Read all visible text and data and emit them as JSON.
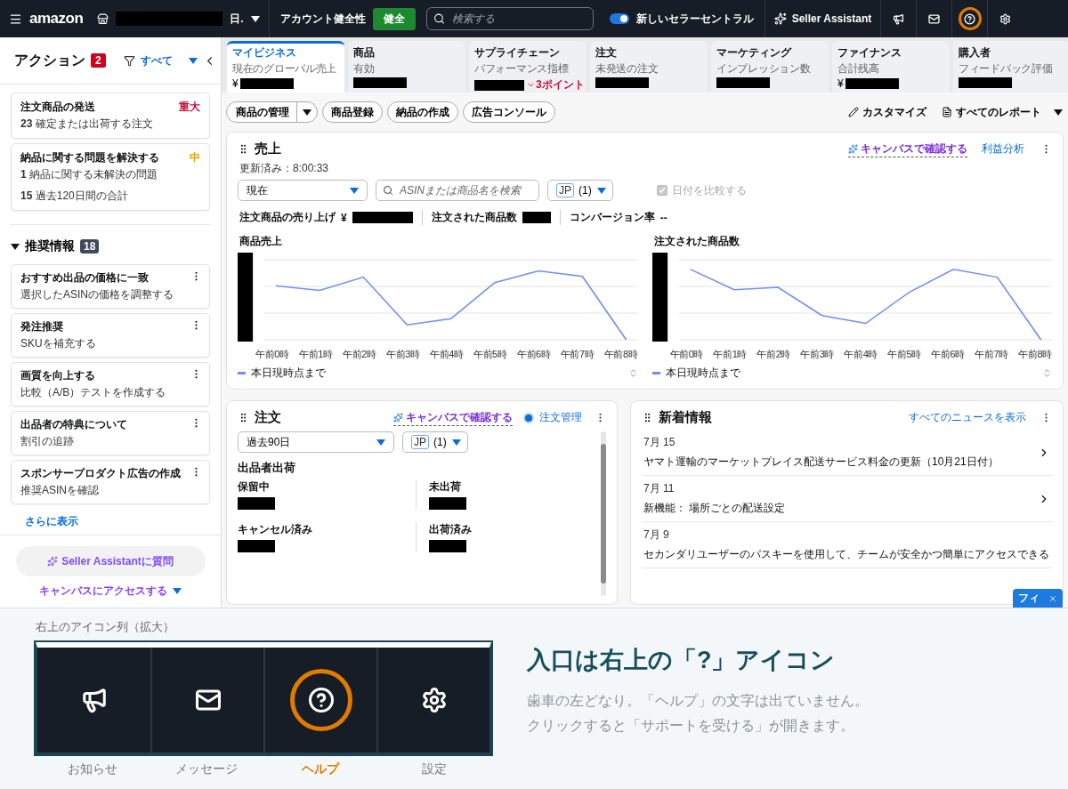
{
  "topbar": {
    "logo": "amazon",
    "store_menu": "日.",
    "health_label": "アカウント健全性",
    "health_status": "健全",
    "search_placeholder": "検索する",
    "new_ui": {
      "label": "新しいセラーセントラル",
      "on": true
    },
    "assistant": "Seller Assistant",
    "icons": [
      {
        "kind": "megaphone",
        "highlighted": false
      },
      {
        "kind": "mail",
        "highlighted": false
      },
      {
        "kind": "help",
        "highlighted": true
      },
      {
        "kind": "gear",
        "highlighted": false
      }
    ]
  },
  "sidebar": {
    "title": "アクション",
    "count": "2",
    "filter": "すべて",
    "actions": [
      {
        "title": "注文商品の発送",
        "priority": "重大",
        "color": "#cc0c39",
        "lines": [
          {
            "count": "23",
            "text": "確定または出荷する注文"
          }
        ]
      },
      {
        "title": "納品に関する問題を解決する",
        "priority": "中",
        "color": "#e3a008",
        "lines": [
          {
            "count": "1",
            "text": "納品に関する未解決の問題"
          },
          {
            "count": "15",
            "text": "過去120日間の合計"
          }
        ]
      }
    ],
    "recommendations": {
      "title": "推奨情報",
      "count": "18",
      "expanded": true,
      "items": [
        {
          "title": "おすすめ出品の価格に一致",
          "text": "選択したASINの価格を調整する"
        },
        {
          "title": "発注推奨",
          "text": "SKUを補充する"
        },
        {
          "title": "画質を向上する",
          "text": "比較（A/B）テストを作成する"
        },
        {
          "title": "出品者の特典について",
          "text": "割引の追跡"
        },
        {
          "title": "スポンサープロダクト広告の作成",
          "text": "推奨ASINを確認"
        }
      ]
    },
    "more": "さらに表示",
    "assistant_button": "Seller Assistantに質問",
    "canvas_link": "キャンバスにアクセスする"
  },
  "tabs": [
    {
      "title": "マイビジネス",
      "subtitle": "現在のグローバル売上",
      "currency": "¥",
      "selected": true
    },
    {
      "title": "商品",
      "subtitle": "有効",
      "selected": false
    },
    {
      "title": "サプライチェーン",
      "subtitle": "パフォーマンス指標",
      "delta": "3ポイント",
      "selected": false
    },
    {
      "title": "注文",
      "subtitle": "未発送の注文",
      "selected": false
    },
    {
      "title": "マーケティング",
      "subtitle": "インプレッション数",
      "selected": false
    },
    {
      "title": "ファイナンス",
      "subtitle": "合計残高",
      "currency": "¥",
      "selected": false
    },
    {
      "title": "購入者",
      "subtitle": "フィードバック評価",
      "selected": false
    }
  ],
  "quick_actions": [
    {
      "label": "商品の管理",
      "kind": "split"
    },
    {
      "label": "商品登録",
      "kind": "plain"
    },
    {
      "label": "納品の作成",
      "kind": "plain"
    },
    {
      "label": "広告コンソール",
      "kind": "plain"
    }
  ],
  "tools": {
    "customize": "カスタマイズ",
    "reports": "すべてのレポート"
  },
  "sales": {
    "title": "売上",
    "canvas_link": "キャンバスで確認する",
    "link": "利益分析",
    "updated": "更新済み：8:00:33",
    "period": "現在",
    "search_placeholder": "ASINまたは商品名を検索",
    "marketplace": "JP",
    "marketplace_count": "(1)",
    "compare": {
      "label": "日付を比較する",
      "checked": true,
      "disabled": true
    },
    "metrics": [
      {
        "label": "注文商品の売り上げ",
        "prefix": "¥"
      },
      {
        "label": "注文された商品数"
      },
      {
        "label": "コンバージョン率",
        "value": "--"
      }
    ],
    "charts": [
      {
        "title": "商品売上",
        "x_labels": [
          "午前0時",
          "午前1時",
          "午前2時",
          "午前3時",
          "午前4時",
          "午前5時",
          "午前6時",
          "午前7時",
          "午前8時"
        ],
        "legend": "本日現時点まで"
      },
      {
        "title": "注文された商品数",
        "x_labels": [
          "午前0時",
          "午前1時",
          "午前2時",
          "午前3時",
          "午前4時",
          "午前5時",
          "午前6時",
          "午前7時",
          "午前8時"
        ],
        "legend": "本日現時点まで"
      }
    ]
  },
  "orders": {
    "title": "注文",
    "canvas_link": "キャンバスで確認する",
    "toggle": {
      "label": "注文管理",
      "on": true
    },
    "period": "過去90日",
    "marketplace": "JP",
    "marketplace_count": "(1)",
    "section": "出品者出荷",
    "stats": [
      "保留中",
      "未出荷",
      "キャンセル済み",
      "出荷済み"
    ]
  },
  "news": {
    "title": "新着情報",
    "link": "すべてのニュースを表示",
    "items": [
      {
        "date": "7月 15",
        "title": "ヤマト運輸のマーケットプレイス配送サービス料金の更新（10月21日付）"
      },
      {
        "date": "7月 11",
        "title": "新機能： 場所ごとの配送設定"
      },
      {
        "date": "7月 9",
        "title": "セカンダリユーザーのパスキーを使用して、チームが安全かつ簡単にアクセスできる"
      }
    ],
    "feedback": "フィ"
  },
  "annotation": {
    "caption": "右上のアイコン列（拡大）",
    "icons": [
      {
        "kind": "megaphone",
        "label": "お知らせ",
        "selected": false
      },
      {
        "kind": "mail",
        "label": "メッセージ",
        "selected": false
      },
      {
        "kind": "help",
        "label": "ヘルプ",
        "selected": true
      },
      {
        "kind": "gear",
        "label": "設定",
        "selected": false
      }
    ],
    "heading": "入口は右上の「?」アイコン",
    "body": [
      "歯車の左どなり。「ヘルプ」の文字は出ていません。",
      "クリックすると「サポートを受ける」が開きます。"
    ]
  }
}
